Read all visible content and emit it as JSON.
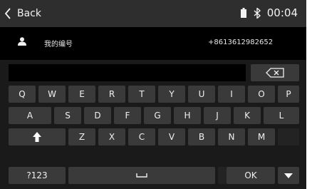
{
  "status_bar": {
    "back_label": "Back",
    "time": "00:04",
    "battery_icon": "battery-icon",
    "bluetooth_icon": "bluetooth-icon"
  },
  "contact": {
    "avatar_icon": "person-icon",
    "name": "我的编号",
    "number": "+8613612982652"
  },
  "keyboard": {
    "input_value": "",
    "row1": [
      "Q",
      "W",
      "E",
      "R",
      "T",
      "Y",
      "U",
      "I",
      "O",
      "P"
    ],
    "row2": [
      "A",
      "S",
      "D",
      "F",
      "G",
      "H",
      "J",
      "K",
      "L"
    ],
    "row3": [
      "Z",
      "X",
      "C",
      "V",
      "B",
      "N",
      "M"
    ],
    "symbols_label": "?123",
    "ok_label": "OK",
    "backspace_icon": "backspace-icon",
    "shift_icon": "shift-icon",
    "space_icon": "space-icon",
    "hide_icon": "chevron-down-icon"
  }
}
